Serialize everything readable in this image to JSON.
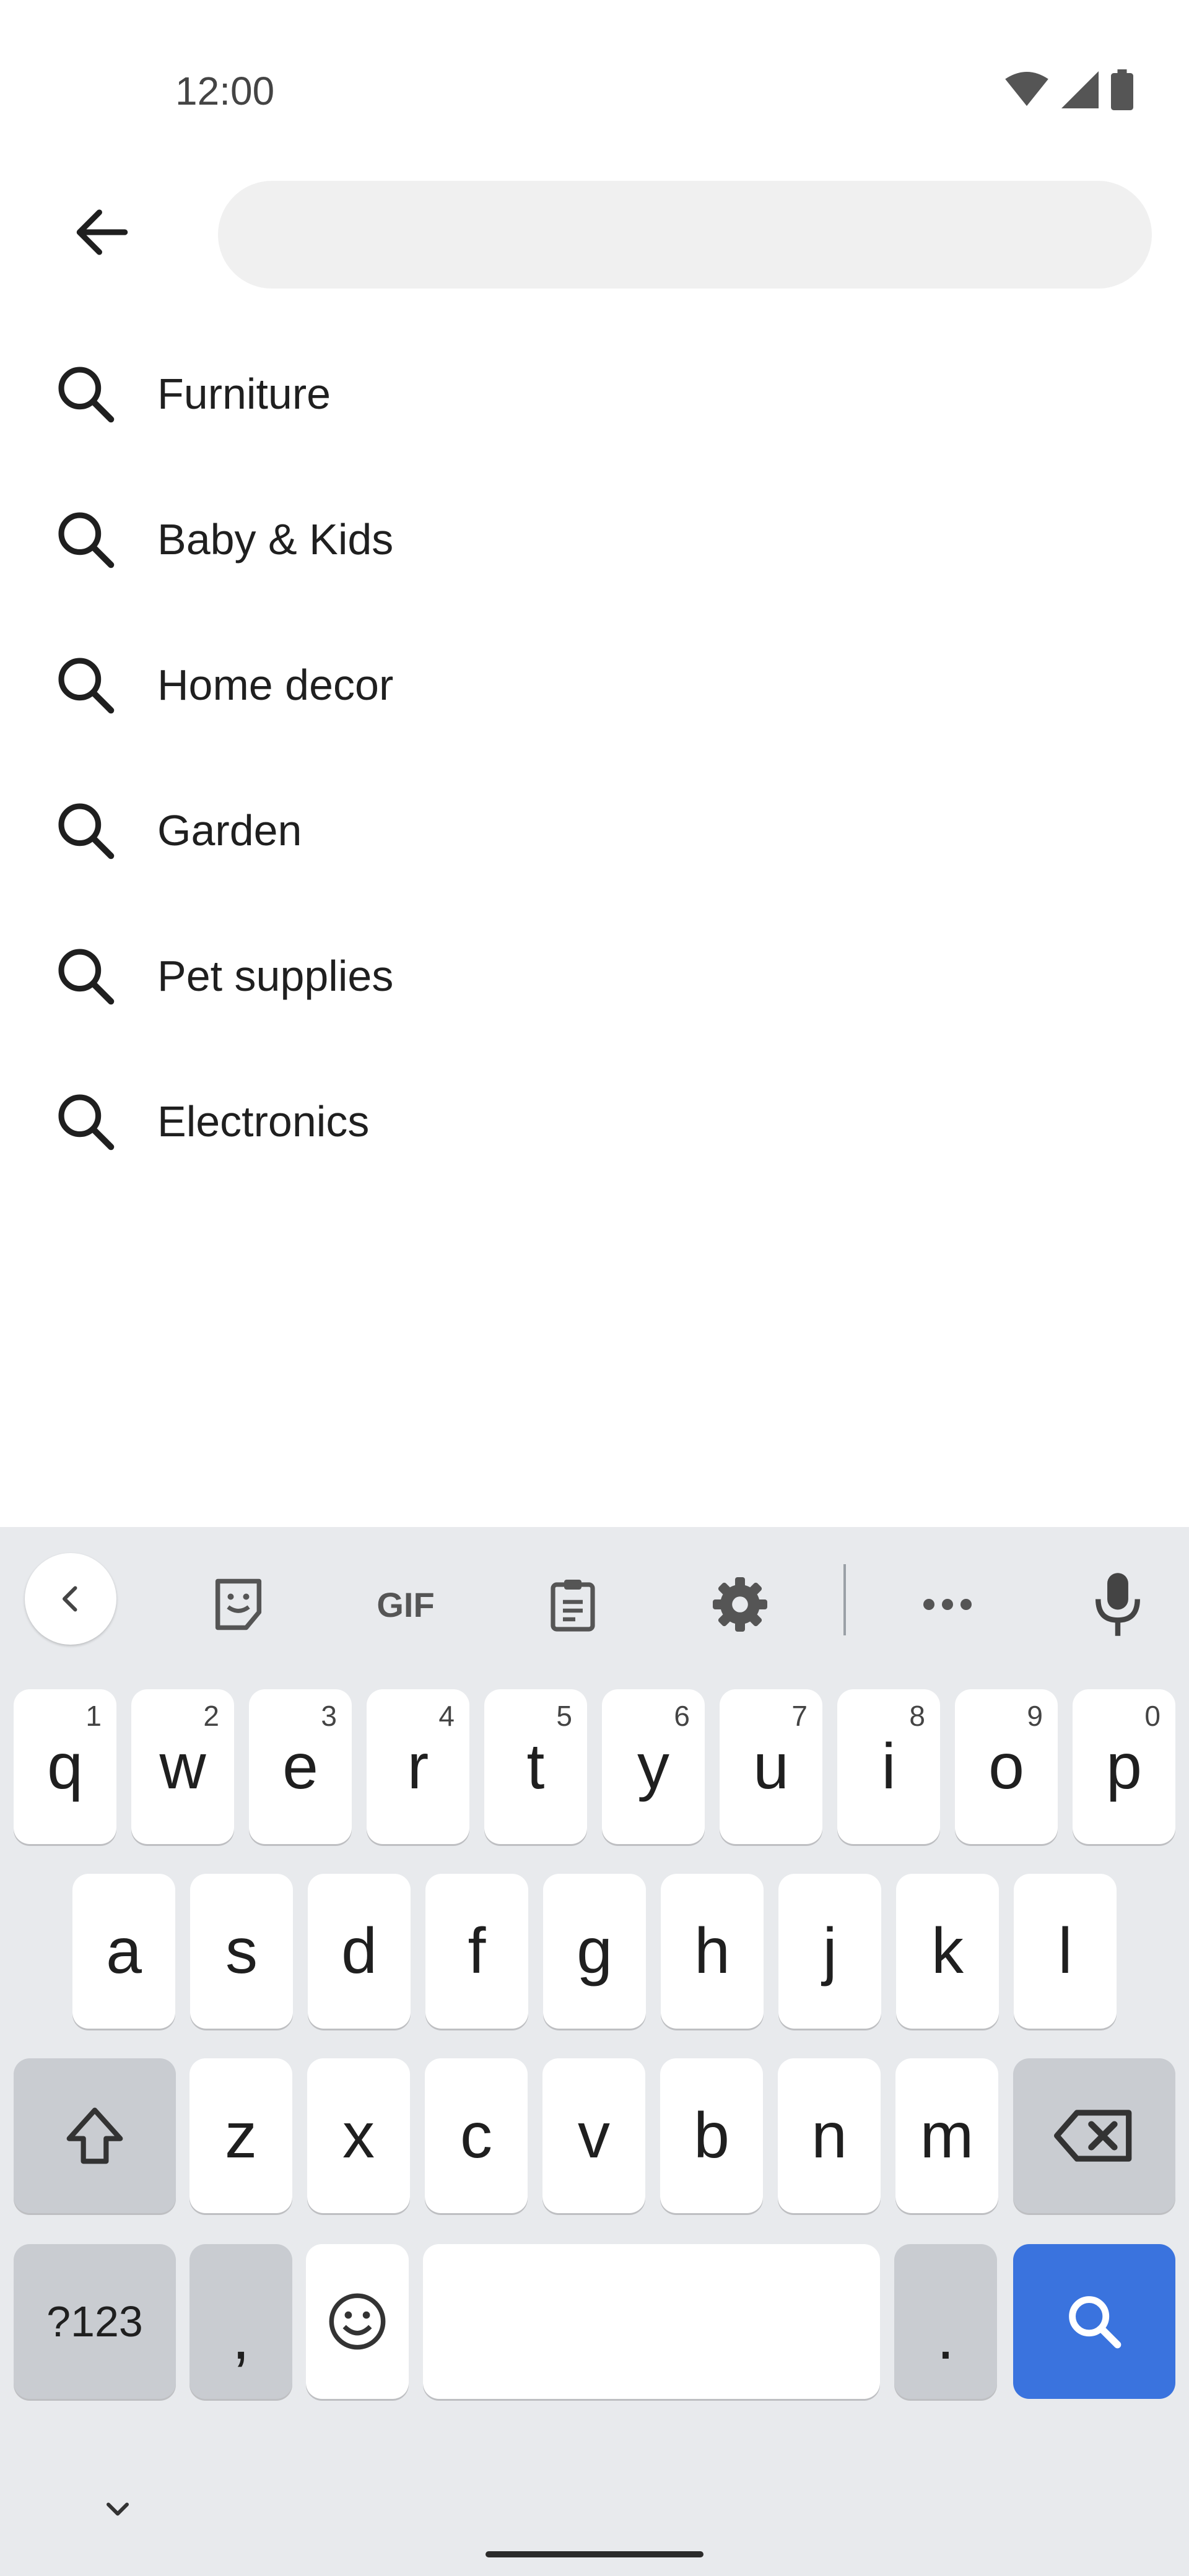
{
  "status": {
    "time": "12:00"
  },
  "search": {
    "placeholder": "",
    "value": ""
  },
  "suggestions": [
    {
      "label": "Furniture"
    },
    {
      "label": "Baby & Kids"
    },
    {
      "label": "Home decor"
    },
    {
      "label": "Garden"
    },
    {
      "label": "Pet supplies"
    },
    {
      "label": "Electronics"
    }
  ],
  "keyboard": {
    "toolbar": {
      "gif_label": "GIF"
    },
    "row1": [
      {
        "key": "q",
        "hint": "1"
      },
      {
        "key": "w",
        "hint": "2"
      },
      {
        "key": "e",
        "hint": "3"
      },
      {
        "key": "r",
        "hint": "4"
      },
      {
        "key": "t",
        "hint": "5"
      },
      {
        "key": "y",
        "hint": "6"
      },
      {
        "key": "u",
        "hint": "7"
      },
      {
        "key": "i",
        "hint": "8"
      },
      {
        "key": "o",
        "hint": "9"
      },
      {
        "key": "p",
        "hint": "0"
      }
    ],
    "row2": [
      "a",
      "s",
      "d",
      "f",
      "g",
      "h",
      "j",
      "k",
      "l"
    ],
    "row3": [
      "z",
      "x",
      "c",
      "v",
      "b",
      "n",
      "m"
    ],
    "row4": {
      "symbols_label": "?123",
      "comma": ",",
      "period": "."
    }
  },
  "colors": {
    "accent": "#3a73de",
    "keyboard_bg": "#e8eaed",
    "search_bg": "#f0f0f0"
  }
}
